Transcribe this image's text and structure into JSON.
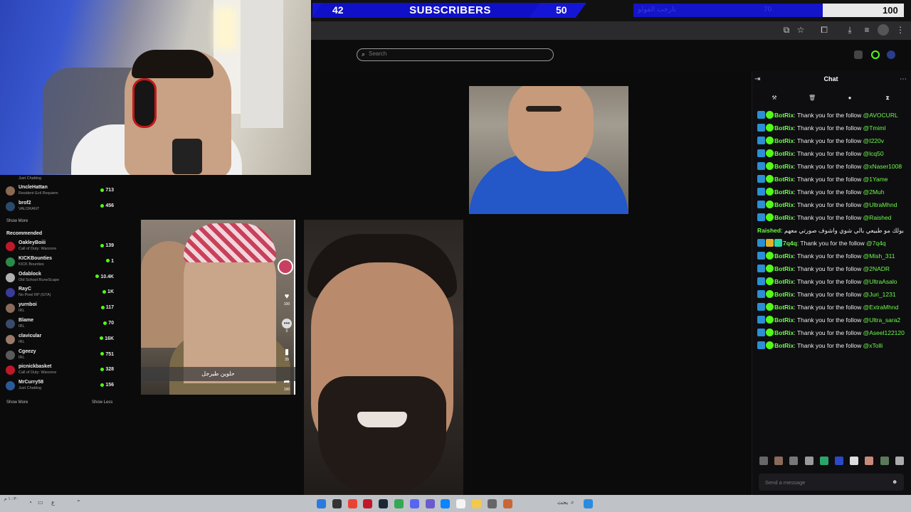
{
  "goal_bar": {
    "subs_current": "42",
    "subs_label": "SUBSCRIBERS",
    "subs_target": "50",
    "right_goal_label": "تارجت الفولو",
    "right_goal_mid": "70",
    "right_goal_max": "100"
  },
  "search": {
    "placeholder": "Search"
  },
  "chat": {
    "title": "Chat",
    "input_placeholder": "Send a message",
    "messages": [
      {
        "user": "BotRix",
        "text": "Thank you for the follow",
        "mention": "@AVOCURL"
      },
      {
        "user": "BotRix",
        "text": "Thank you for the follow",
        "mention": "@Tmiml"
      },
      {
        "user": "BotRix",
        "text": "Thank you for the follow",
        "mention": "@I220v"
      },
      {
        "user": "BotRix",
        "text": "Thank you for the follow",
        "mention": "@lcq50"
      },
      {
        "user": "BotRix",
        "text": "Thank you for the follow",
        "mention": "@xNaser1008"
      },
      {
        "user": "BotRix",
        "text": "Thank you for the follow",
        "mention": "@1Yame"
      },
      {
        "user": "BotRix",
        "text": "Thank you for the follow",
        "mention": "@2Muh"
      },
      {
        "user": "BotRix",
        "text": "Thank you for the follow",
        "mention": "@UltraMhnd"
      },
      {
        "user": "BotRix",
        "text": "Thank you for the follow",
        "mention": "@Raished"
      },
      {
        "user": "Raished",
        "text": "بولك مو طبيعي بالي شوي واشوف صورتي معهم",
        "mention": ""
      },
      {
        "user": "7q4q",
        "text": "Thank you for the follow",
        "mention": "@7q4q"
      },
      {
        "user": "BotRix",
        "text": "Thank you for the follow",
        "mention": "@Mish_311"
      },
      {
        "user": "BotRix",
        "text": "Thank you for the follow",
        "mention": "@2NADR"
      },
      {
        "user": "BotRix",
        "text": "Thank you for the follow",
        "mention": "@UltraAsalo"
      },
      {
        "user": "BotRix",
        "text": "Thank you for the follow",
        "mention": "@Juri_1231"
      },
      {
        "user": "BotRix",
        "text": "Thank you for the follow",
        "mention": "@ExtraMhnd"
      },
      {
        "user": "BotRix",
        "text": "Thank you for the follow",
        "mention": "@Ultra_sara2"
      },
      {
        "user": "BotRix",
        "text": "Thank you for the follow",
        "mention": "@Aseel122120"
      },
      {
        "user": "BotRix",
        "text": "Thank you for the follow",
        "mention": "@xTolli"
      }
    ]
  },
  "sidebar": {
    "top_rows": [
      {
        "name": "",
        "game": "Just Chatting",
        "count": ""
      },
      {
        "name": "UncleHattan",
        "game": "Resident Evil Requiem",
        "count": "713"
      },
      {
        "name": "brof2",
        "game": "VALORANT",
        "count": "456"
      }
    ],
    "show_more_1": "Show More",
    "recommended_title": "Recommended",
    "recommended": [
      {
        "name": "OakleyBoiii",
        "game": "Call of Duty: Warzone",
        "count": "139"
      },
      {
        "name": "KICKBounties",
        "game": "KICK Bounties",
        "count": "1"
      },
      {
        "name": "Odablock",
        "game": "Old School RuneScape",
        "count": "10.4K"
      },
      {
        "name": "RayC",
        "game": "No Pixel RP (GTA)",
        "count": "1K"
      },
      {
        "name": "yurnboi",
        "game": "IRL",
        "count": "117"
      },
      {
        "name": "Blame",
        "game": "IRL",
        "count": "70"
      },
      {
        "name": "clavicular",
        "game": "IRL",
        "count": "16K"
      },
      {
        "name": "Cgeezy",
        "game": "IRL",
        "count": "751"
      },
      {
        "name": "picnickbasket",
        "game": "Call of Duty: Warzone",
        "count": "328"
      },
      {
        "name": "MrCurry58",
        "game": "Just Chatting",
        "count": "156"
      }
    ],
    "show_more_2": "Show More",
    "show_less": "Show Less"
  },
  "tiktok": {
    "caption": "حلوين طيرجل",
    "like_count": "100",
    "comment_count": "0",
    "save_count": "39",
    "share_count": "100"
  },
  "taskbar": {
    "search_label": "بحث",
    "clock": "١٠:٣٠ م"
  },
  "colors": {
    "accent_green": "#53fc18",
    "goal_blue": "#1515d6"
  }
}
